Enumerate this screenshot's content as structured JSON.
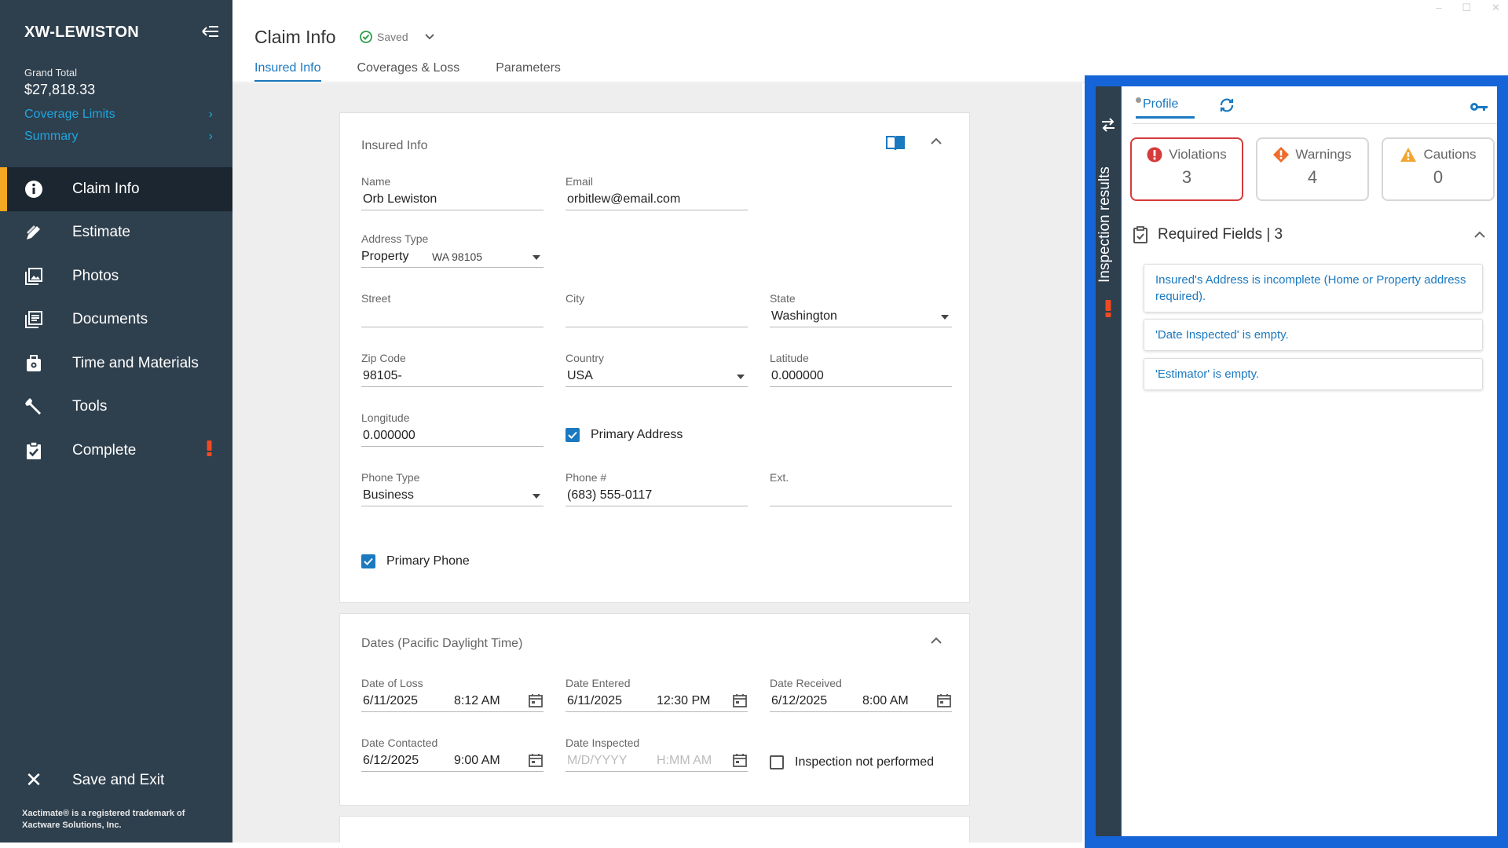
{
  "window": {
    "minimize": "–",
    "maximize": "☐",
    "close": "✕"
  },
  "sidebar": {
    "title": "XW-LEWISTON",
    "grand_total_label": "Grand Total",
    "grand_total_value": "$27,818.33",
    "links": [
      {
        "label": "Coverage Limits",
        "chevron": "›"
      },
      {
        "label": "Summary",
        "chevron": "›"
      }
    ],
    "nav": [
      {
        "label": "Claim Info",
        "icon": "info-icon",
        "active": true
      },
      {
        "label": "Estimate",
        "icon": "pencil-ruler-icon"
      },
      {
        "label": "Photos",
        "icon": "photos-icon"
      },
      {
        "label": "Documents",
        "icon": "documents-icon"
      },
      {
        "label": "Time and Materials",
        "icon": "toolbox-icon"
      },
      {
        "label": "Tools",
        "icon": "wrench-icon"
      },
      {
        "label": "Complete",
        "icon": "clipboard-check-icon",
        "alert": true
      }
    ],
    "save_exit": "Save and Exit",
    "footer": "Xactimate® is a registered trademark of Xactware Solutions, Inc."
  },
  "header": {
    "title": "Claim Info",
    "saved": "Saved",
    "tabs": [
      "Insured Info",
      "Coverages & Loss",
      "Parameters"
    ]
  },
  "insured": {
    "title": "Insured Info",
    "name_label": "Name",
    "name": "Orb Lewiston",
    "email_label": "Email",
    "email": "orbitlew@email.com",
    "address_type_label": "Address Type",
    "address_type": "Property",
    "address_type_sub": "WA 98105",
    "street_label": "Street",
    "street": "",
    "city_label": "City",
    "city": "",
    "state_label": "State",
    "state": "Washington",
    "zip_label": "Zip Code",
    "zip": "98105-",
    "country_label": "Country",
    "country": "USA",
    "lat_label": "Latitude",
    "lat": "0.000000",
    "lon_label": "Longitude",
    "lon": "0.000000",
    "primary_address": "Primary Address",
    "phone_type_label": "Phone Type",
    "phone_type": "Business",
    "phone_label": "Phone #",
    "phone": "(683) 555-0117",
    "ext_label": "Ext.",
    "ext": "",
    "primary_phone": "Primary Phone"
  },
  "dates": {
    "title": "Dates (Pacific Daylight Time)",
    "loss_label": "Date of Loss",
    "loss_date": "6/11/2025",
    "loss_time": "8:12 AM",
    "entered_label": "Date Entered",
    "entered_date": "6/11/2025",
    "entered_time": "12:30 PM",
    "received_label": "Date Received",
    "received_date": "6/12/2025",
    "received_time": "8:00 AM",
    "contacted_label": "Date Contacted",
    "contacted_date": "6/12/2025",
    "contacted_time": "9:00 AM",
    "inspected_label": "Date Inspected",
    "inspected_date_ph": "M/D/YYYY",
    "inspected_time_ph": "H:MM AM",
    "not_performed": "Inspection not performed"
  },
  "inspection": {
    "rail_title": "Inspection results",
    "tab_profile": "Profile",
    "violations_label": "Violations",
    "violations": "3",
    "warnings_label": "Warnings",
    "warnings": "4",
    "cautions_label": "Cautions",
    "cautions": "0",
    "required_title": "Required Fields | 3",
    "items": [
      "Insured's Address is incomplete (Home or Property address required).",
      "'Date Inspected' is empty.",
      "'Estimator' is empty."
    ]
  },
  "colors": {
    "sidebar": "#2e3f4d",
    "active_nav": "#1b2630",
    "accent": "#f5a623",
    "link": "#1b79c0",
    "panel_border": "#1565d8",
    "violation": "#d63b3b"
  }
}
